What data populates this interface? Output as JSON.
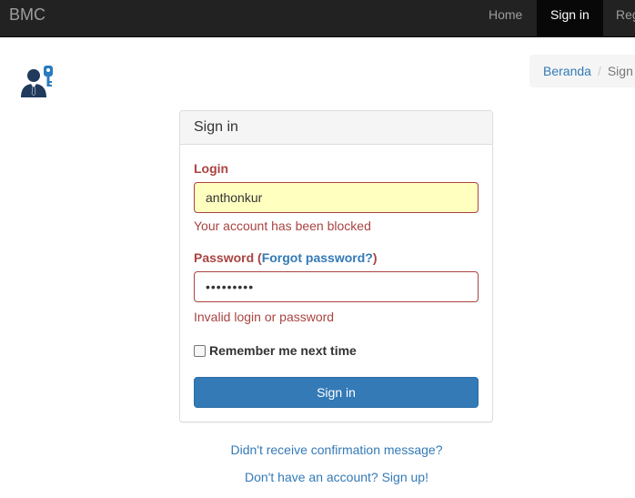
{
  "navbar": {
    "brand": "BMC",
    "items": [
      {
        "label": "Home",
        "active": false
      },
      {
        "label": "Sign in",
        "active": true
      },
      {
        "label": "Register",
        "active": false
      }
    ]
  },
  "logo": {
    "icon": "user-key-icon"
  },
  "breadcrumb": {
    "home": "Beranda",
    "separator": "/",
    "current": "Sign in"
  },
  "panel": {
    "title": "Sign in",
    "login_label": "Login",
    "login_value": "anthonkur",
    "login_error": "Your account has been blocked",
    "password_label_prefix": "Password (",
    "forgot_password_link": "Forgot password?",
    "password_label_suffix": ")",
    "password_value": "•••••••••",
    "password_error": "Invalid login or password",
    "remember_label": "Remember me next time",
    "remember_checked": false,
    "submit_label": "Sign in"
  },
  "links": {
    "confirmation": "Didn't receive confirmation message?",
    "signup": "Don't have an account? Sign up!"
  },
  "colors": {
    "navbar_bg": "#222222",
    "nav_active_bg": "#080808",
    "error": "#a94442",
    "link": "#337ab7",
    "primary_button": "#337ab7",
    "autofill_bg": "#ffffc0"
  }
}
